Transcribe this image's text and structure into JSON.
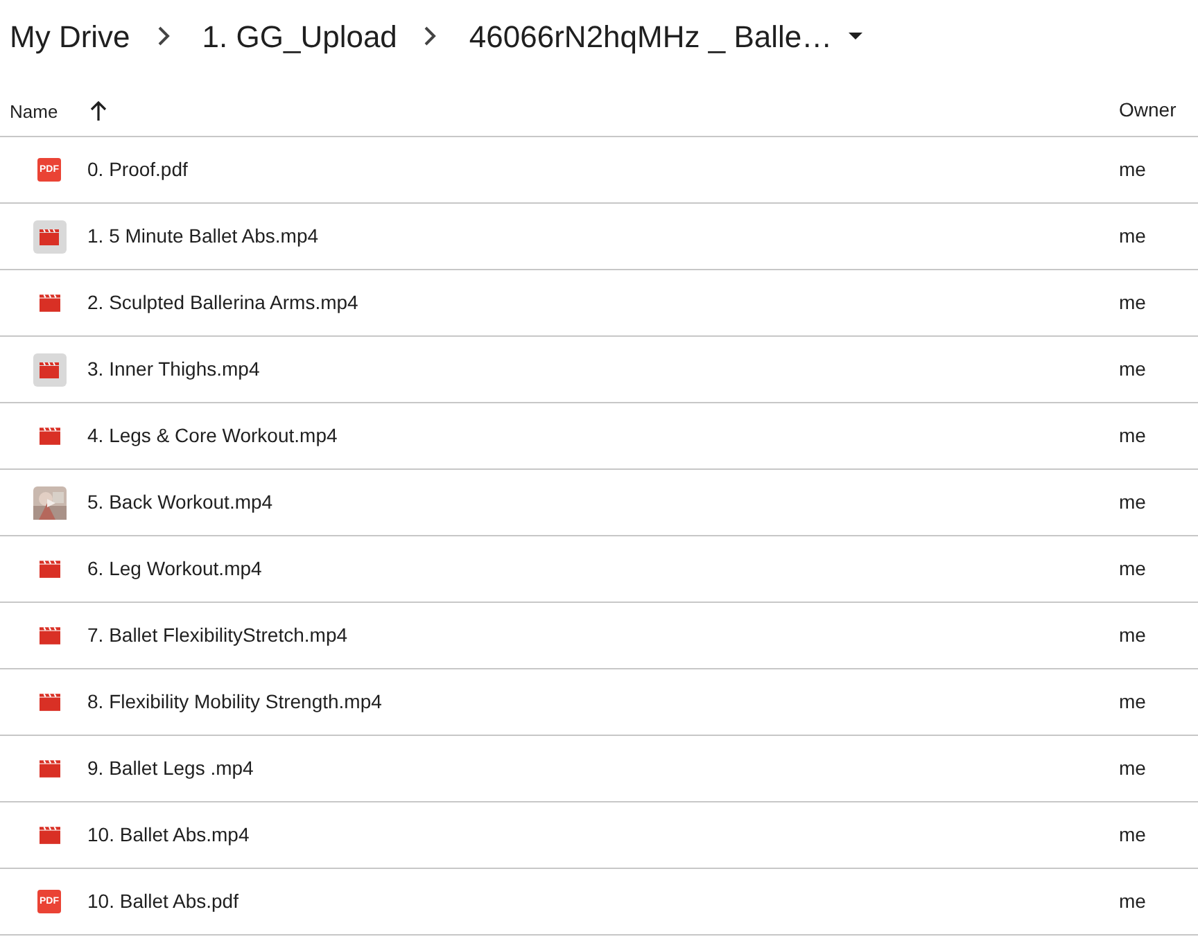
{
  "breadcrumb": [
    "My Drive",
    "1. GG_Upload",
    "46066rN2hqMHz _ Balle…"
  ],
  "columns": {
    "name": "Name",
    "sort_ascending": true,
    "owner": "Owner"
  },
  "files": [
    {
      "kind": "pdf",
      "icon_text": "PDF",
      "name": "0. Proof.pdf",
      "owner": "me"
    },
    {
      "kind": "video-thumb",
      "name": "1. 5 Minute Ballet Abs.mp4",
      "owner": "me"
    },
    {
      "kind": "video",
      "name": "2. Sculpted Ballerina Arms.mp4",
      "owner": "me"
    },
    {
      "kind": "video-thumb",
      "name": "3. Inner Thighs.mp4",
      "owner": "me"
    },
    {
      "kind": "video",
      "name": "4. Legs & Core Workout.mp4",
      "owner": "me"
    },
    {
      "kind": "photo-thumb",
      "name": "5. Back Workout.mp4",
      "owner": "me"
    },
    {
      "kind": "video",
      "name": "6. Leg Workout.mp4",
      "owner": "me"
    },
    {
      "kind": "video",
      "name": "7. Ballet FlexibilityStretch.mp4",
      "owner": "me"
    },
    {
      "kind": "video",
      "name": "8. Flexibility Mobility Strength.mp4",
      "owner": "me"
    },
    {
      "kind": "video",
      "name": "9. Ballet Legs .mp4",
      "owner": "me"
    },
    {
      "kind": "video",
      "name": "10. Ballet Abs.mp4",
      "owner": "me"
    },
    {
      "kind": "pdf",
      "icon_text": "PDF",
      "name": "10. Ballet Abs.pdf",
      "owner": "me"
    }
  ]
}
